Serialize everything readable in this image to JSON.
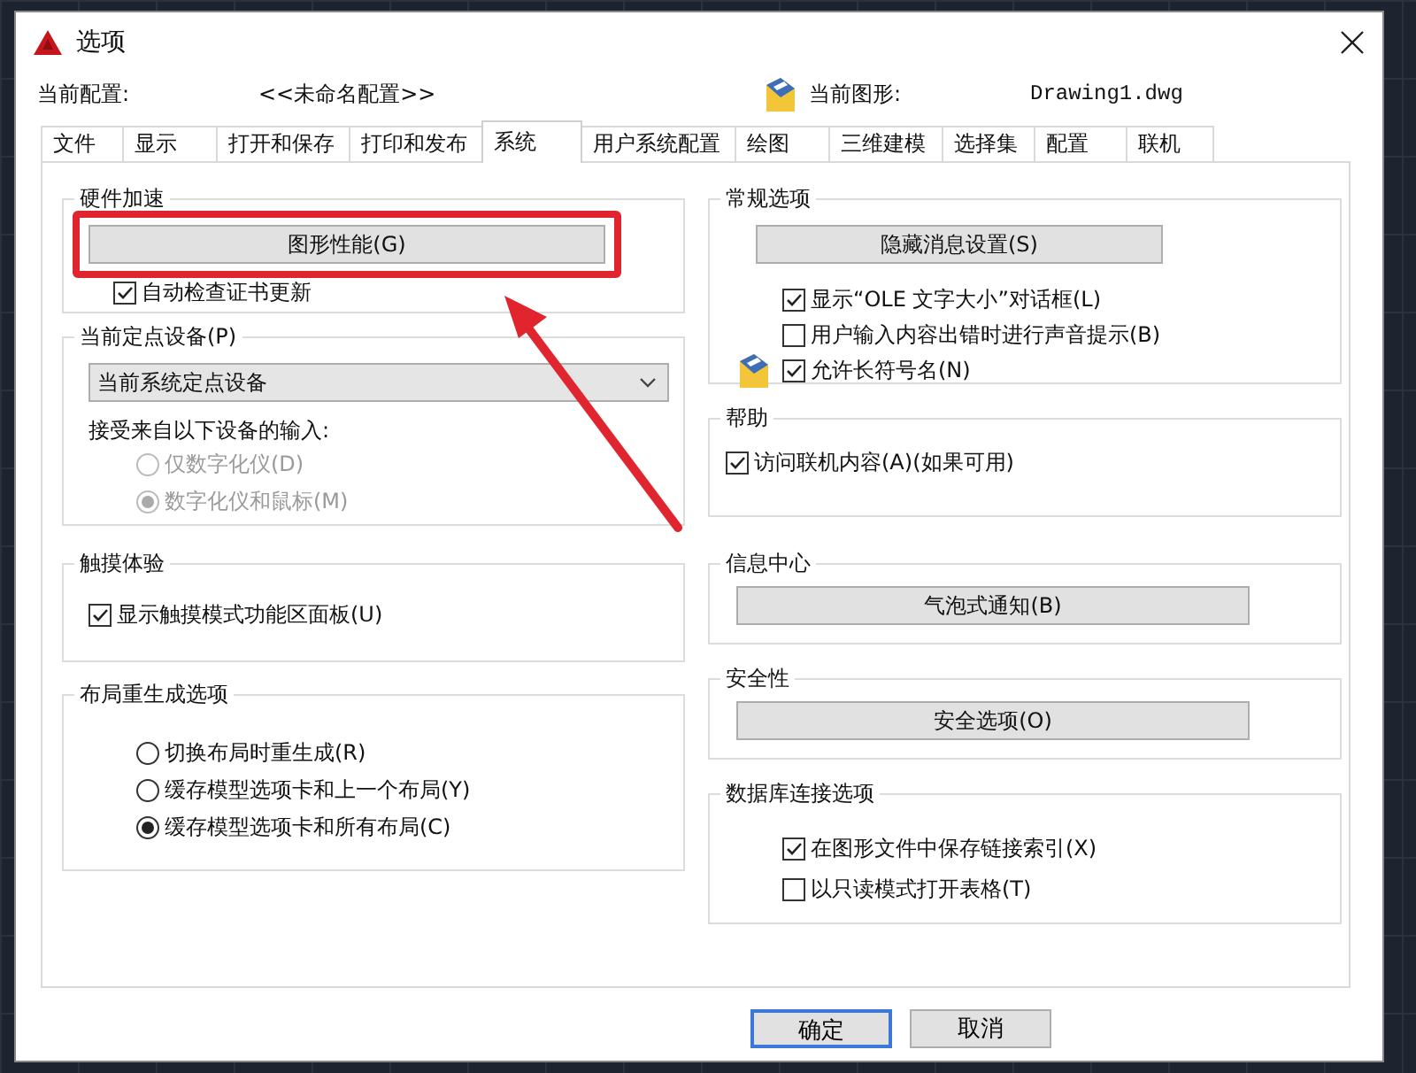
{
  "window": {
    "title": "选项"
  },
  "profile": {
    "label": "当前配置:",
    "value": "<<未命名配置>>"
  },
  "drawing": {
    "label": "当前图形:",
    "value": "Drawing1.dwg"
  },
  "tabs": [
    {
      "label": "文件",
      "selected": false
    },
    {
      "label": "显示",
      "selected": false
    },
    {
      "label": "打开和保存",
      "selected": false
    },
    {
      "label": "打印和发布",
      "selected": false
    },
    {
      "label": "系统",
      "selected": true
    },
    {
      "label": "用户系统配置",
      "selected": false
    },
    {
      "label": "绘图",
      "selected": false
    },
    {
      "label": "三维建模",
      "selected": false
    },
    {
      "label": "选择集",
      "selected": false
    },
    {
      "label": "配置",
      "selected": false
    },
    {
      "label": "联机",
      "selected": false
    }
  ],
  "left_groups": [
    {
      "title": "硬件加速",
      "items": [
        {
          "kind": "button",
          "label": "图形性能(G)",
          "highlighted": true
        },
        {
          "kind": "checkbox",
          "label": "自动检查证书更新",
          "checked": true
        }
      ]
    },
    {
      "title": "当前定点设备(P)",
      "items": [
        {
          "kind": "select",
          "value": "当前系统定点设备"
        },
        {
          "kind": "text",
          "label": "接受来自以下设备的输入:"
        },
        {
          "kind": "radio",
          "label": "仅数字化仪(D)",
          "selected": false,
          "disabled": true
        },
        {
          "kind": "radio",
          "label": "数字化仪和鼠标(M)",
          "selected": true,
          "disabled": true
        }
      ]
    },
    {
      "title": "触摸体验",
      "items": [
        {
          "kind": "checkbox",
          "label": "显示触摸模式功能区面板(U)",
          "checked": true
        }
      ]
    },
    {
      "title": "布局重生成选项",
      "items": [
        {
          "kind": "radio",
          "label": "切换布局时重生成(R)",
          "selected": false,
          "disabled": false
        },
        {
          "kind": "radio",
          "label": "缓存模型选项卡和上一个布局(Y)",
          "selected": false,
          "disabled": false
        },
        {
          "kind": "radio",
          "label": "缓存模型选项卡和所有布局(C)",
          "selected": true,
          "disabled": false
        }
      ]
    }
  ],
  "right_groups": [
    {
      "title": "常规选项",
      "items": [
        {
          "kind": "button",
          "label": "隐藏消息设置(S)",
          "highlighted": false
        },
        {
          "kind": "checkbox",
          "label": "显示“OLE 文字大小”对话框(L)",
          "checked": true
        },
        {
          "kind": "checkbox",
          "label": "用户输入内容出错时进行声音提示(B)",
          "checked": false
        },
        {
          "kind": "checkbox",
          "label": "允许长符号名(N)",
          "checked": true,
          "icon": true
        }
      ]
    },
    {
      "title": "帮助",
      "items": [
        {
          "kind": "checkbox",
          "label": "访问联机内容(A)(如果可用)",
          "checked": true
        }
      ]
    },
    {
      "title": "信息中心",
      "items": [
        {
          "kind": "button",
          "label": "气泡式通知(B)",
          "highlighted": false
        }
      ]
    },
    {
      "title": "安全性",
      "items": [
        {
          "kind": "button",
          "label": "安全选项(O)",
          "highlighted": false
        }
      ]
    },
    {
      "title": "数据库连接选项",
      "items": [
        {
          "kind": "checkbox",
          "label": "在图形文件中保存链接索引(X)",
          "checked": true
        },
        {
          "kind": "checkbox",
          "label": "以只读模式打开表格(T)",
          "checked": false
        }
      ]
    }
  ],
  "footer_buttons": [
    {
      "label": "确定",
      "default": true
    },
    {
      "label": "取消",
      "default": false
    }
  ]
}
